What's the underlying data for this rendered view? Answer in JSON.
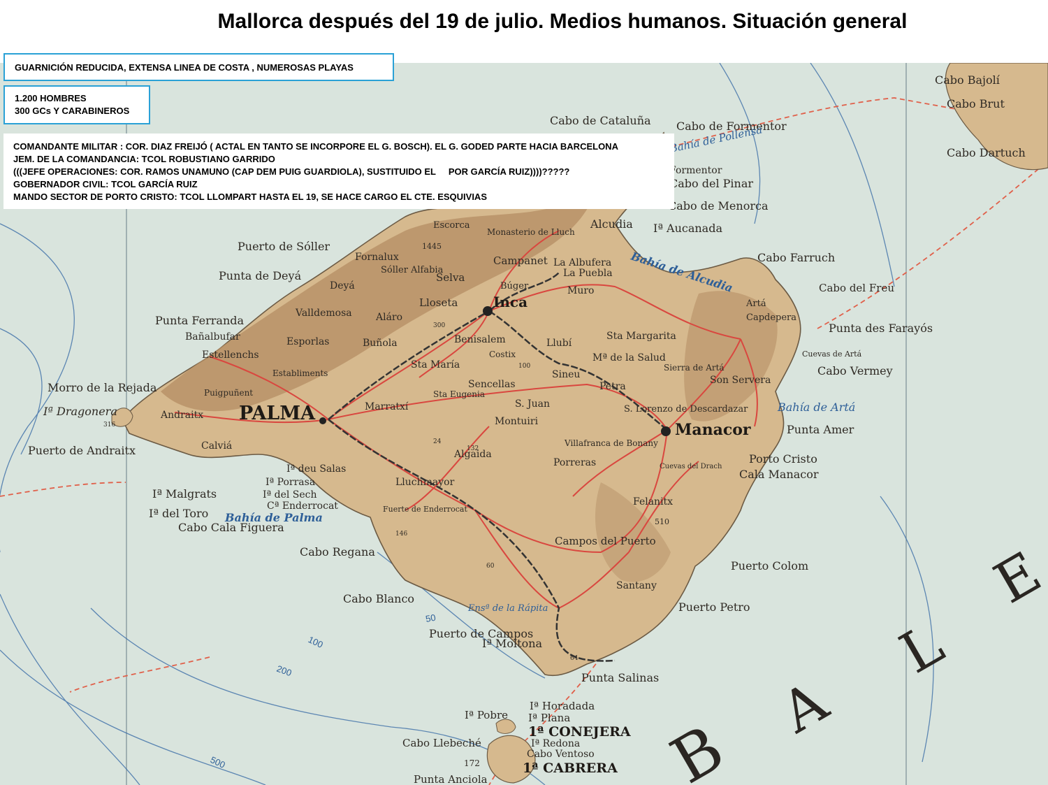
{
  "title": "Mallorca después del 19 de julio. Medios humanos. Situación general",
  "info": {
    "box1": "GUARNICIÓN REDUCIDA, EXTENSA LINEA DE COSTA , NUMEROSAS PLAYAS",
    "box2": [
      "1.200 HOMBRES",
      "300 GCs Y CARABINEROS"
    ],
    "box3": [
      "COMANDANTE MILITAR : COR. DIAZ FREIJÓ ( ACTAL EN TANTO SE INCORPORE EL G. BOSCH). EL G. GODED PARTE HACIA BARCELONA",
      "JEM. DE LA COMANDANCIA: TCOL ROBUSTIANO GARRIDO",
      "(((JEFE OPERACIONES: COR. RAMOS UNAMUNO (CAP DEM PUIG GUARDIOLA), SUSTITUIDO EL     POR GARCÍA RUIZ))))?????",
      "GOBERNADOR CIVIL: TCOL GARCÍA RUIZ",
      "MANDO SECTOR DE PORTO CRISTO: TCOL LLOMPART HASTA EL 19, SE HACE CARGO EL CTE. ESQUIVIAS"
    ]
  },
  "colors": {
    "sea": "#d9e4dd",
    "land": "#d6b98e",
    "mountain": "#b48d63",
    "road": "#d9473f",
    "railway": "#333333",
    "route": "#e0604a",
    "box_border": "#2aa1d6"
  },
  "map": {
    "big_labels": [
      "PALMA",
      "Manacor",
      "Inca",
      "1ª CONEJERA",
      "1ª CABRERA"
    ],
    "places": [
      "Cabo Bajolí",
      "Cabo Brut",
      "Cabo Dartuch",
      "Cabo de Cataluña",
      "Cabo de Formentor",
      "Formentor",
      "Cabo del Pinar",
      "Cabo de Menorca",
      "Iª Aucanada",
      "Alcudia",
      "Escorca",
      "Monasterio de Lluch",
      "1445",
      "Puerto de Sóller",
      "Fornalux",
      "Sóller",
      "Alfabia",
      "Campanet",
      "La Albufera",
      "La Puebla",
      "Muro",
      "Búger",
      "Selva",
      "Lloseta",
      "Punta de Deyá",
      "Deyá",
      "Valldemosa",
      "Aláro",
      "Buñola",
      "Benisalem",
      "Punta Ferranda",
      "Bañalbufar",
      "Estellenchs",
      "Esporlas",
      "Establiments",
      "Sta María",
      "Costix",
      "Llubí",
      "Sta Margarita",
      "Mª de la Salud",
      "Sineu",
      "Cabo Farruch",
      "Cabo del Freu",
      "Artá",
      "Capdepera",
      "Punta des Farayós",
      "Cuevas de Artá",
      "Cabo Vermey",
      "Son Servera",
      "Sierra de Artá",
      "Morro de la Rejada",
      "Iª Dragonera",
      "Andraitx",
      "Puigpuñent",
      "Marratxí",
      "Sta Eugenia",
      "Sencellas",
      "S. Juan",
      "Petra",
      "S. Lorenzo de Descardazar",
      "Bahía de Artá",
      "Punta Amer",
      "Puerto de Andraitx",
      "Calviá",
      "Montuiri",
      "Villafranca de Bonany",
      "Algaida",
      "Porreras",
      "Cuevas del Drach",
      "Porto Cristo",
      "Cala Manacor",
      "Iª deu Salas",
      "Iª Porrasa",
      "Iª del Sech",
      "Iª Malgrats",
      "Iª del Toro",
      "Cª Enderrocat",
      "Cabo Cala Figuera",
      "Lluchmayor",
      "Fuerte de Enderrocat",
      "Felanitx",
      "510",
      "Campos del Puerto",
      "Puerto Colom",
      "Cabo Regana",
      "Cabo Blanco",
      "Santany",
      "Puerto Petro",
      "Puerto de Campos",
      "Iª Moltona",
      "Punta Salinas",
      "Iª Horadada",
      "Iª Plana",
      "Iª Pobre",
      "Cabo Llebeché",
      "Iª Redona",
      "Cabo Ventoso",
      "Punta Anciola",
      "172",
      "316",
      "132",
      "146",
      "60",
      "100",
      "300",
      "24",
      "64"
    ],
    "sea_labels": [
      "Bahía de Alcudia",
      "Bahía de Palma",
      "Ensª de la Rápita",
      "Bahía de Pollensa"
    ],
    "depths": [
      "50",
      "100",
      "200",
      "500"
    ],
    "big_sea_letters": [
      "B",
      "A",
      "L",
      "E"
    ]
  }
}
